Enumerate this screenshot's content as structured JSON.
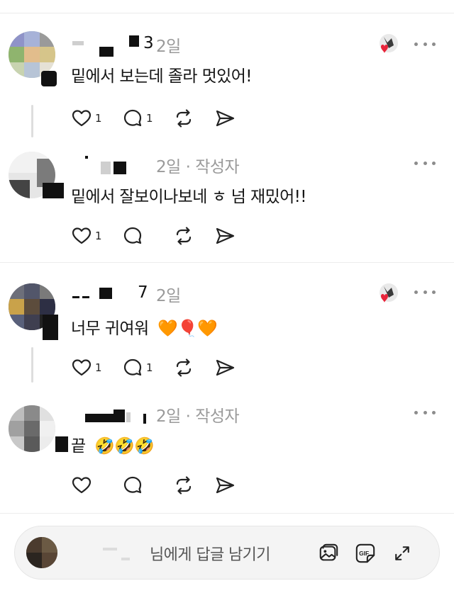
{
  "comments": [
    {
      "username_suffix": "3",
      "time": "2일",
      "body": "밑에서 보는데 졸라 멋있어!",
      "likes": "1",
      "replies": "1",
      "author_liked": true
    },
    {
      "username_suffix": "",
      "time": "2일 · 작성자",
      "body": "밑에서 잘보이나보네 ㅎ 넘 재밌어!!",
      "likes": "1",
      "replies": "",
      "author_liked": false
    },
    {
      "username_suffix": "7",
      "time": "2일",
      "body": "너무 귀여워",
      "emoji": "🧡🎈🧡",
      "likes": "1",
      "replies": "1",
      "author_liked": true
    },
    {
      "username_suffix": "",
      "time": "2일 · 작성자",
      "body": "끝",
      "emoji": "🤣🤣🤣",
      "likes": "",
      "replies": "",
      "author_liked": false
    }
  ],
  "reply_bar": {
    "placeholder": "님에게 답글 남기기",
    "tools": [
      "image-icon",
      "gif-icon",
      "expand-icon"
    ]
  },
  "icons": {
    "like": "heart-icon",
    "reply": "comment-bubble-icon",
    "repost": "repost-icon",
    "share": "send-icon",
    "more": "more-dots-icon"
  },
  "colors": {
    "meta_gray": "#9a9a9a",
    "heart_red": "#e8243a",
    "divider": "#ececec"
  }
}
